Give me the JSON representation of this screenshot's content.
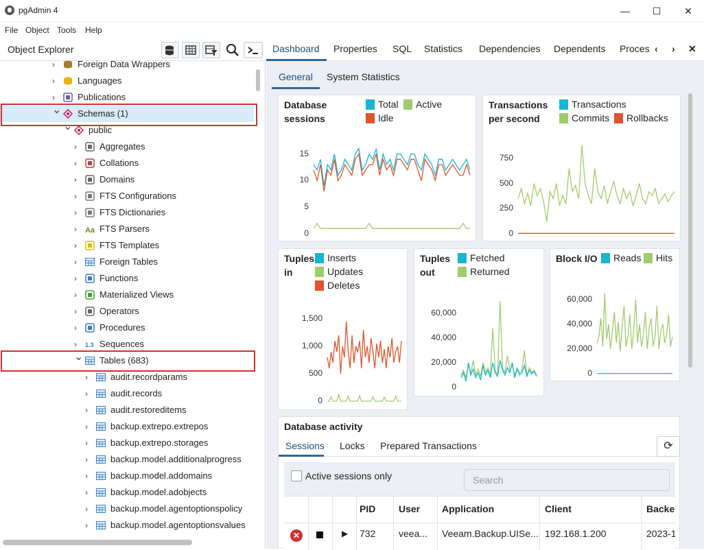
{
  "window": {
    "title": "pgAdmin 4",
    "minimize": "—",
    "maximize": "☐",
    "close": "✕"
  },
  "menu": [
    "File",
    "Object",
    "Tools",
    "Help"
  ],
  "explorer": {
    "title": "Object Explorer",
    "tree": [
      {
        "label": "Foreign Data Wrappers",
        "icon": "foreign-data-wrapper-icon",
        "expanded": false
      },
      {
        "label": "Languages",
        "icon": "language-icon",
        "expanded": false
      },
      {
        "label": "Publications",
        "icon": "publication-icon",
        "expanded": false
      },
      {
        "label": "Schemas (1)",
        "icon": "schemas-icon",
        "expanded": true,
        "selected": true
      },
      {
        "label": "public",
        "icon": "schema-icon",
        "expanded": true
      },
      {
        "label": "Aggregates",
        "icon": "aggregate-icon",
        "expanded": false
      },
      {
        "label": "Collations",
        "icon": "collation-icon",
        "expanded": false
      },
      {
        "label": "Domains",
        "icon": "domain-icon",
        "expanded": false
      },
      {
        "label": "FTS Configurations",
        "icon": "fts-configuration-icon",
        "expanded": false
      },
      {
        "label": "FTS Dictionaries",
        "icon": "fts-dictionary-icon",
        "expanded": false
      },
      {
        "label": "FTS Parsers",
        "icon": "fts-parser-icon",
        "expanded": false
      },
      {
        "label": "FTS Templates",
        "icon": "fts-template-icon",
        "expanded": false
      },
      {
        "label": "Foreign Tables",
        "icon": "foreign-table-icon",
        "expanded": false
      },
      {
        "label": "Functions",
        "icon": "function-icon",
        "expanded": false
      },
      {
        "label": "Materialized Views",
        "icon": "materialized-view-icon",
        "expanded": false
      },
      {
        "label": "Operators",
        "icon": "operator-icon",
        "expanded": false
      },
      {
        "label": "Procedures",
        "icon": "procedure-icon",
        "expanded": false
      },
      {
        "label": "Sequences",
        "icon": "sequence-icon",
        "expanded": false
      },
      {
        "label": "Tables (683)",
        "icon": "tables-icon",
        "expanded": true
      },
      {
        "label": "audit.recordparams",
        "icon": "table-icon",
        "expanded": false
      },
      {
        "label": "audit.records",
        "icon": "table-icon",
        "expanded": false
      },
      {
        "label": "audit.restoreditems",
        "icon": "table-icon",
        "expanded": false
      },
      {
        "label": "backup.extrepo.extrepos",
        "icon": "table-icon",
        "expanded": false
      },
      {
        "label": "backup.extrepo.storages",
        "icon": "table-icon",
        "expanded": false
      },
      {
        "label": "backup.model.additionalprogress",
        "icon": "table-icon",
        "expanded": false
      },
      {
        "label": "backup.model.addomains",
        "icon": "table-icon",
        "expanded": false
      },
      {
        "label": "backup.model.adobjects",
        "icon": "table-icon",
        "expanded": false
      },
      {
        "label": "backup.model.agentoptionspolicy",
        "icon": "table-icon",
        "expanded": false
      },
      {
        "label": "backup.model.agentoptionsvalues",
        "icon": "table-icon",
        "expanded": false
      }
    ]
  },
  "tabs": [
    "Dashboard",
    "Properties",
    "SQL",
    "Statistics",
    "Dependencies",
    "Dependents",
    "Proces"
  ],
  "subtabs": [
    "General",
    "System Statistics"
  ],
  "colors": {
    "total": "#17b5d2",
    "active": "#9fcc6c",
    "idle": "#e0532b",
    "inserts": "#17b5d2",
    "updates": "#9fcc6c",
    "deletes": "#e0532b"
  },
  "cards": {
    "db_sessions": {
      "title1": "Database",
      "title2": "sessions",
      "legend": [
        "Total",
        "Active",
        "Idle"
      ]
    },
    "tps": {
      "title1": "Transactions",
      "title2": "per second",
      "legend": [
        "Transactions",
        "Commits",
        "Rollbacks"
      ]
    },
    "tuples_in": {
      "title1": "Tuples",
      "title2": "in",
      "legend": [
        "Inserts",
        "Updates",
        "Deletes"
      ]
    },
    "tuples_out": {
      "title1": "Tuples",
      "title2": "out",
      "legend": [
        "Fetched",
        "Returned"
      ]
    },
    "block_io": {
      "title1": "Block I/O",
      "legend": [
        "Reads",
        "Hits"
      ]
    }
  },
  "chart_data": [
    {
      "type": "line",
      "title": "Database sessions",
      "yticks": [
        "15",
        "10",
        "5",
        "0"
      ],
      "ylim": [
        0,
        17
      ],
      "series": [
        {
          "name": "Total",
          "values": [
            13,
            12,
            14,
            9,
            13,
            12,
            15,
            11,
            12,
            14,
            13,
            12,
            15,
            16,
            12,
            13,
            15,
            14,
            16,
            12,
            15,
            13,
            14,
            12,
            15,
            15,
            14,
            13,
            15,
            15,
            13,
            12,
            15,
            14,
            13,
            11,
            14,
            14,
            12,
            13,
            14,
            13,
            12,
            13,
            14,
            12
          ]
        },
        {
          "name": "Active",
          "values": [
            1,
            2,
            1,
            1,
            1,
            1,
            1,
            1,
            1,
            1,
            1,
            1,
            1,
            1,
            1,
            1,
            2,
            1,
            1,
            1,
            1,
            1,
            1,
            1,
            1,
            1,
            1,
            1,
            1,
            1,
            1,
            1,
            1,
            1,
            1,
            1,
            1,
            1,
            1,
            1,
            1,
            1,
            1,
            2,
            1,
            1
          ]
        },
        {
          "name": "Idle",
          "values": [
            12,
            10,
            13,
            8,
            12,
            11,
            14,
            10,
            11,
            13,
            12,
            11,
            14,
            15,
            11,
            12,
            13,
            13,
            15,
            11,
            14,
            12,
            13,
            11,
            14,
            14,
            13,
            12,
            14,
            14,
            12,
            10,
            14,
            13,
            12,
            10,
            13,
            13,
            11,
            12,
            13,
            12,
            11,
            11,
            13,
            11
          ]
        }
      ]
    },
    {
      "type": "line",
      "title": "Transactions per second",
      "yticks": [
        "750",
        "500",
        "250",
        "0"
      ],
      "ylim": [
        0,
        900
      ],
      "series": [
        {
          "name": "Transactions",
          "values": []
        },
        {
          "name": "Commits",
          "values": [
            350,
            450,
            300,
            400,
            280,
            500,
            380,
            450,
            320,
            120,
            420,
            350,
            500,
            280,
            380,
            300,
            650,
            420,
            480,
            350,
            880,
            500,
            380,
            300,
            650,
            420,
            350,
            480,
            300,
            420,
            520,
            380,
            300,
            450,
            350,
            420,
            280,
            380,
            500,
            350,
            300,
            420,
            380,
            450,
            300,
            350,
            400,
            320,
            380,
            420
          ]
        },
        {
          "name": "Rollbacks",
          "values": [
            5,
            5,
            5,
            5,
            5,
            5,
            5,
            5,
            5,
            5,
            5,
            5,
            5,
            5,
            5,
            5,
            5,
            5,
            5,
            5,
            5,
            5,
            5,
            5,
            5,
            5,
            5,
            5,
            5,
            5,
            5,
            5,
            5,
            5,
            5,
            5,
            5,
            5,
            5,
            5,
            5,
            5,
            5,
            5,
            5,
            5,
            5,
            5,
            5,
            5
          ]
        }
      ]
    },
    {
      "type": "line",
      "title": "Tuples in",
      "yticks": [
        "1,500",
        "1,000",
        "500",
        "0"
      ],
      "ylim": [
        0,
        1700
      ],
      "series": [
        {
          "name": "Inserts",
          "values": []
        },
        {
          "name": "Updates",
          "values": [
            0,
            0,
            80,
            0,
            0,
            0,
            120,
            0,
            0,
            0,
            0,
            90,
            0,
            0,
            0,
            0,
            0,
            100,
            0,
            0,
            0,
            0,
            0,
            0,
            80,
            0,
            0,
            0,
            0,
            0,
            70,
            0,
            0,
            0,
            0,
            0,
            90,
            0,
            0,
            0
          ]
        },
        {
          "name": "Deletes",
          "values": [
            800,
            600,
            900,
            700,
            1100,
            900,
            1200,
            500,
            1000,
            800,
            1450,
            900,
            600,
            1200,
            700,
            1000,
            900,
            1100,
            600,
            1300,
            800,
            1000,
            700,
            1150,
            900,
            600,
            1050,
            800,
            1100,
            700,
            950,
            600,
            1000,
            800,
            1150,
            700,
            900,
            1000,
            700,
            1100
          ]
        }
      ]
    },
    {
      "type": "line",
      "title": "Tuples out",
      "yticks": [
        "60,000",
        "40,000",
        "20,000",
        "0"
      ],
      "ylim": [
        0,
        70000
      ],
      "series": [
        {
          "name": "Fetched",
          "values": [
            8000,
            12000,
            5000,
            20000,
            10000,
            15000,
            8000,
            12000,
            6000,
            18000,
            10000,
            14000,
            8000,
            20000,
            12000,
            9000,
            22000,
            14000,
            10000,
            16000,
            12000,
            20000,
            8000,
            15000,
            10000,
            12000,
            18000,
            9000,
            14000,
            11000,
            13000,
            9000
          ]
        },
        {
          "name": "Returned",
          "values": [
            10000,
            14000,
            8000,
            18000,
            12000,
            22000,
            10000,
            15000,
            9000,
            20000,
            12000,
            16000,
            10000,
            48000,
            14000,
            10000,
            70000,
            16000,
            12000,
            26000,
            14000,
            18000,
            10000,
            16000,
            12000,
            14000,
            30000,
            10000,
            16000,
            12000,
            14000,
            10000
          ]
        }
      ]
    },
    {
      "type": "line",
      "title": "Block I/O",
      "yticks": [
        "60,000",
        "40,000",
        "20,000",
        "0"
      ],
      "ylim": [
        0,
        70000
      ],
      "series": [
        {
          "name": "Reads",
          "values": [
            200,
            200,
            200,
            200,
            200,
            200,
            200,
            200,
            200,
            200,
            200,
            200,
            200,
            200,
            200,
            200,
            200,
            200,
            200,
            200,
            200,
            200,
            200,
            200,
            200,
            200,
            200,
            200,
            200,
            200,
            200,
            200,
            200,
            200,
            200,
            200,
            200,
            200,
            200,
            200
          ]
        },
        {
          "name": "Hits",
          "values": [
            25000,
            30000,
            45000,
            22000,
            65000,
            28000,
            40000,
            20000,
            35000,
            50000,
            25000,
            42000,
            18000,
            38000,
            55000,
            22000,
            30000,
            48000,
            20000,
            35000,
            60000,
            25000,
            40000,
            22000,
            32000,
            50000,
            20000,
            38000,
            45000,
            22000,
            30000,
            55000,
            20000,
            35000,
            40000,
            25000,
            32000,
            48000,
            22000,
            30000
          ]
        }
      ]
    }
  ],
  "activity": {
    "title": "Database activity",
    "tabs": [
      "Sessions",
      "Locks",
      "Prepared Transactions"
    ],
    "active_only_label": "Active sessions only",
    "search_placeholder": "Search",
    "columns": [
      "PID",
      "User",
      "Application",
      "Client",
      "Backen"
    ],
    "rows": [
      {
        "pid": "732",
        "user": "veea...",
        "application": "Veeam.Backup.UISe...",
        "client": "192.168.1.200",
        "backend": "2023-1"
      }
    ]
  }
}
